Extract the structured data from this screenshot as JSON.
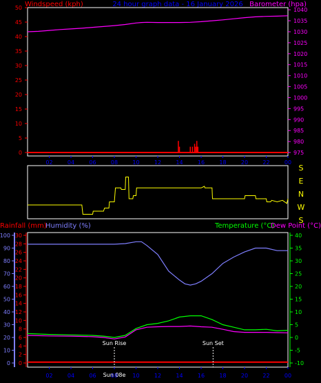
{
  "header": {
    "left_label": "Windspeed (kph)",
    "center_label": "24 hour graph data - 16 January 2026",
    "right_label": "Barometer (hpa)"
  },
  "colors": {
    "background": "#000000",
    "frame": "#ffffff",
    "wind": "#ff0000",
    "barometer": "#ff00ff",
    "direction": "#ffff00",
    "humidity": "#0000ff",
    "humidity_line": "#7f7fff",
    "rainfall": "#ff0000",
    "temperature": "#00ff00",
    "dewpoint": "#ff00ff",
    "x_tick": "#0000ff",
    "header_center": "#0000ff",
    "sun_marker": "#ffffff"
  },
  "bottom_header": {
    "rainfall_label": "Rainfall (mm)",
    "humidity_label": "Humidity (%)",
    "temperature_label": "Temperature (°C)",
    "dewpoint_label": "Dew Point (°C)"
  },
  "sun_labels": {
    "rise": "Sun Rise",
    "set": "Sun Set",
    "rise_axis": "Sun 08e"
  },
  "x_ticks": [
    "02",
    "04",
    "06",
    "08",
    "10",
    "12",
    "14",
    "16",
    "18",
    "20",
    "22",
    "00"
  ],
  "direction_labels": [
    "S",
    "E",
    "N",
    "W",
    "S"
  ],
  "chart_data": [
    {
      "type": "line",
      "x_domain": [
        0,
        24
      ],
      "left_axis": {
        "label": "Windspeed (kph)",
        "ticks": [
          0,
          5,
          10,
          15,
          20,
          25,
          30,
          35,
          40,
          45,
          50
        ],
        "ylim": [
          0,
          50
        ]
      },
      "right_axis": {
        "label": "Barometer (hpa)",
        "ticks": [
          975,
          980,
          985,
          990,
          995,
          1000,
          1005,
          1010,
          1015,
          1020,
          1025,
          1030,
          1035,
          1040
        ],
        "ylim": [
          975,
          1041
        ]
      },
      "series": [
        {
          "name": "Barometer (hpa)",
          "axis": "right",
          "x": [
            0,
            1,
            2,
            3,
            4,
            5,
            6,
            7,
            8,
            9,
            10,
            10.5,
            11,
            12,
            13,
            14,
            15,
            16,
            17,
            18,
            19,
            20,
            21,
            22,
            23,
            24
          ],
          "values": [
            1030,
            1030.2,
            1030.6,
            1031,
            1031.3,
            1031.6,
            1032,
            1032.4,
            1032.8,
            1033.3,
            1034,
            1034.2,
            1034.3,
            1034.2,
            1034.2,
            1034.2,
            1034.3,
            1034.6,
            1035,
            1035.4,
            1035.9,
            1036.4,
            1036.8,
            1037,
            1037.1,
            1037.3
          ]
        },
        {
          "name": "Windspeed (kph)",
          "axis": "left",
          "kind": "spikes",
          "x": [
            13.9,
            14.0,
            15.0,
            15.2,
            15.4,
            15.5,
            15.6,
            15.7
          ],
          "values": [
            4,
            2,
            2,
            2,
            3,
            2,
            4,
            2
          ]
        }
      ]
    },
    {
      "type": "line",
      "x_domain": [
        0,
        24
      ],
      "labels": [
        "S",
        "E",
        "N",
        "W",
        "S"
      ],
      "series": [
        {
          "name": "Wind direction",
          "x": [
            0,
            4,
            4.2,
            5,
            5.1,
            6,
            6.05,
            7,
            7.1,
            7.5,
            7.55,
            8,
            8.1,
            8.6,
            8.65,
            9,
            9.05,
            9.3,
            9.35,
            9.7,
            9.75,
            10,
            10.05,
            12,
            14,
            16,
            16.3,
            16.35,
            16.5,
            17,
            17.05,
            20,
            20.05,
            21,
            21.05,
            22,
            22.05,
            22.4,
            22.5,
            23,
            23.5,
            23.9,
            24
          ],
          "values": [
            0,
            0,
            0,
            0,
            -0.3,
            -0.3,
            -0.2,
            -0.2,
            -0.1,
            -0.1,
            0.1,
            0.1,
            0.55,
            0.55,
            0.5,
            0.5,
            0.9,
            0.9,
            0.2,
            0.2,
            0.3,
            0.3,
            0.55,
            0.55,
            0.55,
            0.55,
            0.6,
            0.55,
            0.55,
            0.55,
            0.2,
            0.2,
            0.3,
            0.3,
            0.2,
            0.2,
            0.1,
            0.1,
            0.15,
            0.1,
            0.15,
            0.05,
            0.2
          ]
        }
      ]
    },
    {
      "type": "line",
      "x_domain": [
        0,
        24
      ],
      "rainfall_axis": {
        "label": "Rainfall (mm)",
        "ticks": [
          0,
          2,
          4,
          6,
          8,
          10,
          12,
          14,
          16,
          18,
          20,
          22,
          24,
          26,
          28,
          30
        ],
        "ylim": [
          0,
          30
        ]
      },
      "humidity_axis": {
        "label": "Humidity (%)",
        "ticks": [
          0,
          10,
          20,
          30,
          40,
          50,
          60,
          70,
          80,
          90,
          100
        ],
        "ylim": [
          0,
          100
        ]
      },
      "temperature_axis": {
        "label": "Temperature (°C)",
        "ticks": [
          -10,
          -5,
          0,
          5,
          10,
          15,
          20,
          25,
          30,
          35,
          40
        ],
        "ylim": [
          -10,
          40
        ]
      },
      "sun_rise_hour": 8.0,
      "sun_set_hour": 17.1,
      "series": [
        {
          "name": "Humidity (%)",
          "axis": "humidity",
          "x": [
            0,
            2,
            4,
            6,
            8,
            9,
            10,
            10.5,
            11,
            12,
            13,
            14,
            14.5,
            15,
            15.5,
            16,
            17,
            18,
            19,
            20,
            21,
            22,
            23,
            24
          ],
          "values": [
            93,
            93,
            93,
            93,
            93,
            93.5,
            95,
            95,
            92,
            85,
            72,
            65,
            62,
            61,
            62,
            64,
            70,
            78,
            83,
            87,
            90,
            90,
            88,
            88
          ]
        },
        {
          "name": "Temperature (°C)",
          "axis": "temperature",
          "x": [
            0,
            2,
            4,
            6,
            7,
            8,
            9,
            10,
            11,
            12,
            13,
            14,
            15,
            16,
            17,
            18,
            19,
            20,
            21,
            22,
            23,
            24
          ],
          "values": [
            1.5,
            1.2,
            1,
            0.8,
            0.5,
            0,
            0.8,
            3.5,
            5,
            5.5,
            6.5,
            8,
            8.5,
            8.5,
            7,
            5,
            4,
            3,
            3,
            3.2,
            2.6,
            2.8
          ]
        },
        {
          "name": "Dew Point (°C)",
          "axis": "temperature",
          "x": [
            0,
            2,
            4,
            6,
            7,
            8,
            9,
            10,
            11,
            12,
            13,
            14,
            15,
            16,
            17,
            18,
            19,
            20,
            21,
            22,
            23,
            24
          ],
          "values": [
            0.8,
            0.6,
            0.5,
            0.3,
            0,
            -0.6,
            0.2,
            3,
            4,
            4.2,
            4.3,
            4.3,
            4.5,
            4.2,
            4,
            3.2,
            2.3,
            2,
            2,
            2,
            1.9,
            1.8
          ]
        },
        {
          "name": "Rainfall (mm)",
          "axis": "rainfall",
          "x": [
            0,
            24
          ],
          "values": [
            0.2,
            0.2
          ]
        }
      ]
    }
  ]
}
